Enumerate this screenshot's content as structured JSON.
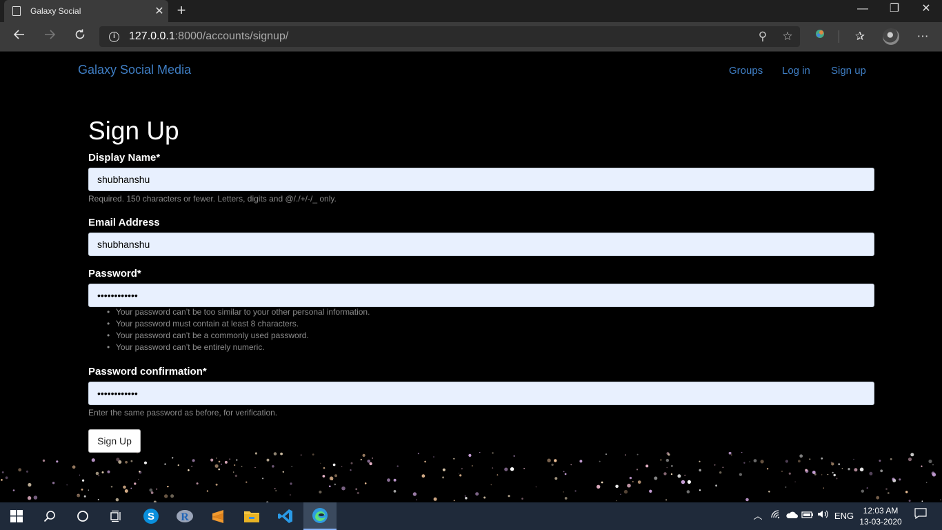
{
  "browser": {
    "tab_title": "Galaxy Social",
    "tab_close": "✕",
    "new_tab": "+",
    "url_host": "127.0.0.1",
    "url_rest": ":8000/accounts/signup/",
    "controls": {
      "minimize": "—",
      "restore": "❐",
      "close": "✕"
    }
  },
  "site": {
    "brand": "Galaxy Social Media",
    "nav": [
      "Groups",
      "Log in",
      "Sign up"
    ]
  },
  "form": {
    "heading": "Sign Up",
    "display_name": {
      "label": "Display Name*",
      "value": "shubhanshu",
      "help": "Required. 150 characters or fewer. Letters, digits and @/./+/-/_ only."
    },
    "email": {
      "label": "Email Address",
      "value": "shubhanshu"
    },
    "password": {
      "label": "Password*",
      "value": "••••••••••••",
      "rules": [
        "Your password can’t be too similar to your other personal information.",
        "Your password must contain at least 8 characters.",
        "Your password can’t be a commonly used password.",
        "Your password can’t be entirely numeric."
      ]
    },
    "password_confirmation": {
      "label": "Password confirmation*",
      "value": "••••••••••••",
      "help": "Enter the same password as before, for verification."
    },
    "submit_label": "Sign Up"
  },
  "taskbar": {
    "language": "ENG",
    "time": "12:03 AM",
    "date": "13-03-2020",
    "apps": [
      "start",
      "search",
      "cortana",
      "task-view",
      "skype",
      "r",
      "sublime",
      "file-explorer",
      "vscode",
      "edge"
    ]
  }
}
